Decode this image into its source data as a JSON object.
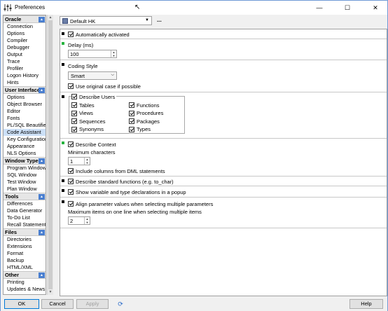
{
  "window": {
    "title": "Preferences"
  },
  "profile": {
    "selected": "Default HK",
    "more_label": "..."
  },
  "sidebar": {
    "groups": [
      {
        "label": "Oracle",
        "items": [
          "Connection",
          "Options",
          "Compiler",
          "Debugger",
          "Output",
          "Trace",
          "Profiler",
          "Logon History",
          "Hints"
        ]
      },
      {
        "label": "User Interface",
        "items": [
          "Options",
          "Object Browser",
          "Editor",
          "Fonts",
          "PL/SQL Beautifier",
          "Code Assistant",
          "Key Configuration",
          "Appearance",
          "NLS Options"
        ]
      },
      {
        "label": "Window Types",
        "items": [
          "Program Window",
          "SQL Window",
          "Test Window",
          "Plan Window"
        ]
      },
      {
        "label": "Tools",
        "items": [
          "Differences",
          "Data Generator",
          "To-Do List",
          "Recall Statement"
        ]
      },
      {
        "label": "Files",
        "items": [
          "Directories",
          "Extensions",
          "Format",
          "Backup",
          "HTML/XML"
        ]
      },
      {
        "label": "Other",
        "items": [
          "Printing",
          "Updates & News"
        ]
      }
    ],
    "selected": "Code Assistant"
  },
  "panel": {
    "auto_activated": {
      "label": "Automatically activated",
      "checked": true
    },
    "delay": {
      "label": "Delay (ms)",
      "value": "100"
    },
    "coding_style": {
      "label": "Coding Style",
      "value": "Smart"
    },
    "use_original_case": {
      "label": "Use original case if possible",
      "checked": true
    },
    "describe_users": {
      "label": "Describe Users",
      "checked": true
    },
    "object_types": [
      {
        "label": "Tables",
        "checked": true
      },
      {
        "label": "Functions",
        "checked": true
      },
      {
        "label": "Views",
        "checked": true
      },
      {
        "label": "Procedures",
        "checked": true
      },
      {
        "label": "Sequences",
        "checked": true
      },
      {
        "label": "Packages",
        "checked": true
      },
      {
        "label": "Synonyms",
        "checked": true
      },
      {
        "label": "Types",
        "checked": true
      }
    ],
    "describe_context": {
      "label": "Describe Context",
      "checked": true
    },
    "min_chars": {
      "label": "Minimum characters",
      "value": "1"
    },
    "include_dml": {
      "label": "Include columns from DML statements",
      "checked": true
    },
    "describe_std": {
      "label": "Describe standard functions (e.g. to_char)",
      "checked": true
    },
    "show_decl": {
      "label": "Show variable and type declarations in a popup",
      "checked": true
    },
    "align_params": {
      "label": "Align parameter values when selecting multiple parameters",
      "checked": true
    },
    "max_items": {
      "label": "Maximum items on one line when selecting multiple items",
      "value": "2"
    }
  },
  "buttons": {
    "ok": "OK",
    "cancel": "Cancel",
    "apply": "Apply",
    "help": "Help"
  },
  "colors": {
    "accent": "#4a7fd0",
    "selection": "#cce0f7",
    "marker_green": "#27b33f"
  }
}
